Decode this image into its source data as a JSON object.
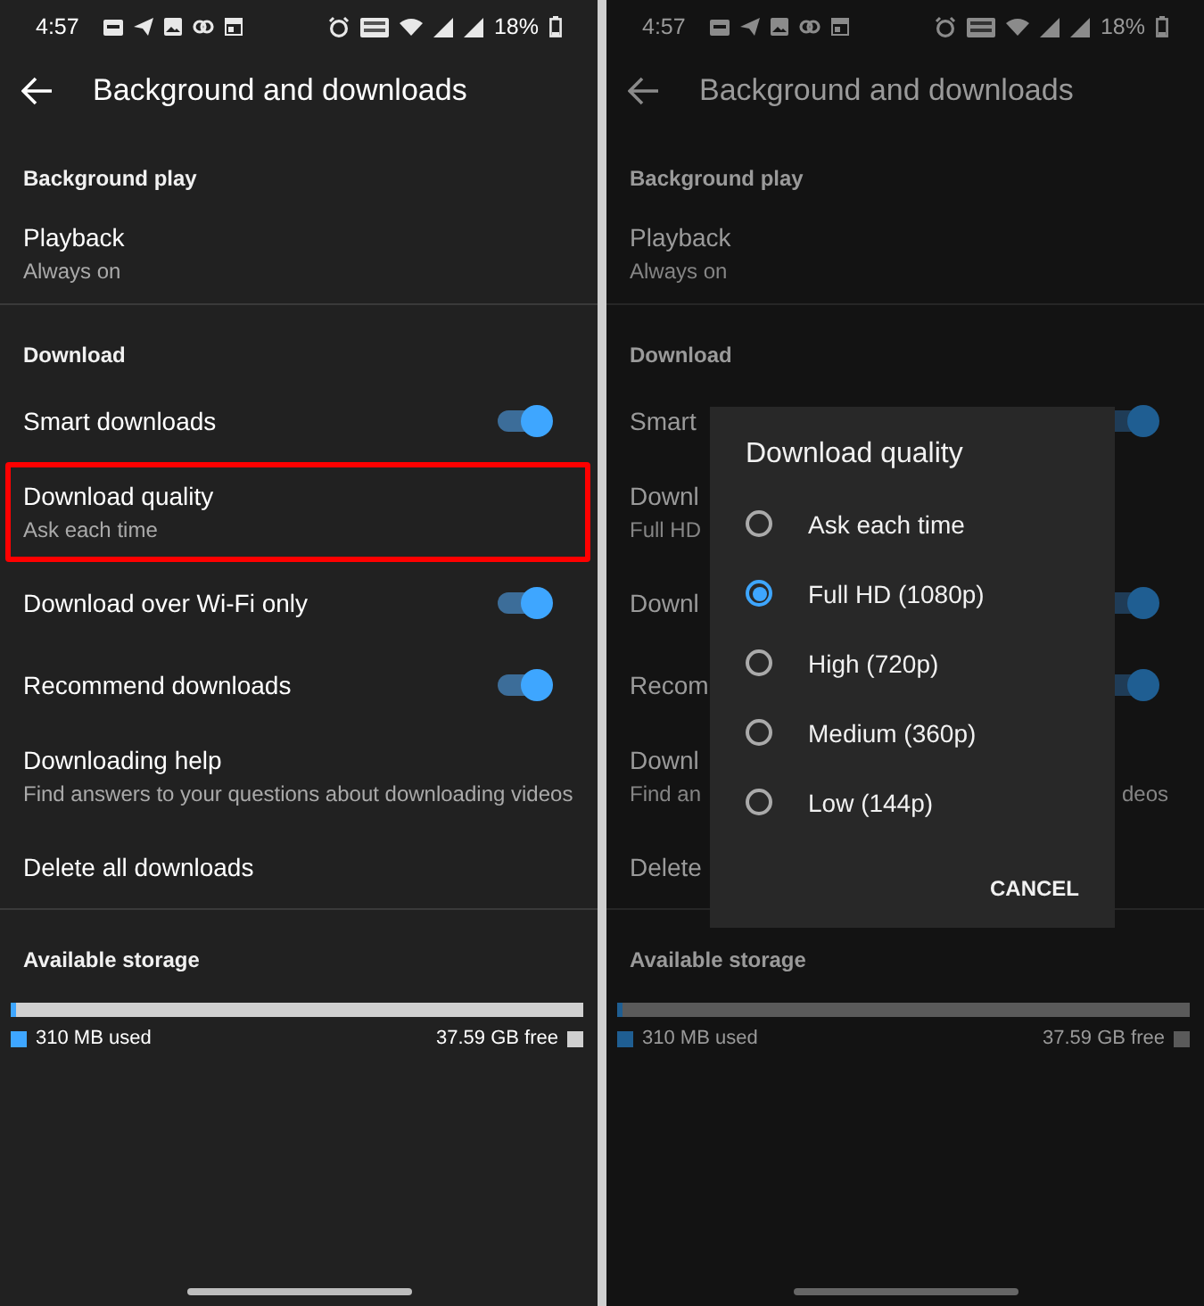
{
  "screens": [
    {
      "dimmed": false,
      "status_bar": {
        "time": "4:57",
        "battery": "18%"
      },
      "header": {
        "title": "Background and downloads"
      },
      "sections": [
        {
          "heading": "Background play",
          "items": [
            {
              "kind": "text",
              "title": "Playback",
              "subtitle": "Always on",
              "highlighted": false
            }
          ]
        },
        {
          "heading": "Download",
          "items": [
            {
              "kind": "toggle",
              "title": "Smart downloads",
              "on": true,
              "highlighted": false
            },
            {
              "kind": "text",
              "title": "Download quality",
              "subtitle": "Ask each time",
              "highlighted": true
            },
            {
              "kind": "toggle",
              "title": "Download over Wi-Fi only",
              "on": true,
              "highlighted": false
            },
            {
              "kind": "toggle",
              "title": "Recommend downloads",
              "on": true,
              "highlighted": false
            },
            {
              "kind": "text",
              "title": "Downloading help",
              "subtitle": "Find answers to your questions about downloading videos",
              "highlighted": false
            },
            {
              "kind": "text",
              "title": "Delete all downloads",
              "highlighted": false
            }
          ]
        }
      ],
      "storage": {
        "heading": "Available storage",
        "level": 0.01,
        "used": "310 MB used",
        "free": "37.59 GB free"
      }
    },
    {
      "dimmed": true,
      "status_bar": {
        "time": "4:57",
        "battery": "18%"
      },
      "header": {
        "title": "Background and downloads"
      },
      "sections": [
        {
          "heading": "Background play",
          "items": [
            {
              "kind": "text",
              "title": "Playback",
              "subtitle": "Always on",
              "highlighted": false
            }
          ]
        },
        {
          "heading": "Download",
          "items": [
            {
              "kind": "toggle",
              "title": "Smart",
              "on": true,
              "highlighted": false
            },
            {
              "kind": "text",
              "title": "Downl",
              "subtitle": "Full HD",
              "highlighted": false
            },
            {
              "kind": "toggle",
              "title": "Downl",
              "on": true,
              "highlighted": false
            },
            {
              "kind": "toggle",
              "title": "Recom",
              "on": true,
              "highlighted": false
            },
            {
              "kind": "text",
              "title": "Downl",
              "subtitle": "Find an",
              "subtitle_tail": "deos",
              "highlighted": false
            },
            {
              "kind": "text",
              "title": "Delete",
              "highlighted": false
            }
          ]
        }
      ],
      "storage": {
        "heading": "Available storage",
        "level": 0.01,
        "used": "310 MB used",
        "free": "37.59 GB free"
      },
      "dialog": {
        "title": "Download quality",
        "options": [
          {
            "label": "Ask each time",
            "selected": false
          },
          {
            "label": "Full HD (1080p)",
            "selected": true
          },
          {
            "label": "High (720p)",
            "selected": false
          },
          {
            "label": "Medium (360p)",
            "selected": false
          },
          {
            "label": "Low (144p)",
            "selected": false
          }
        ],
        "button": "CANCEL"
      }
    }
  ]
}
